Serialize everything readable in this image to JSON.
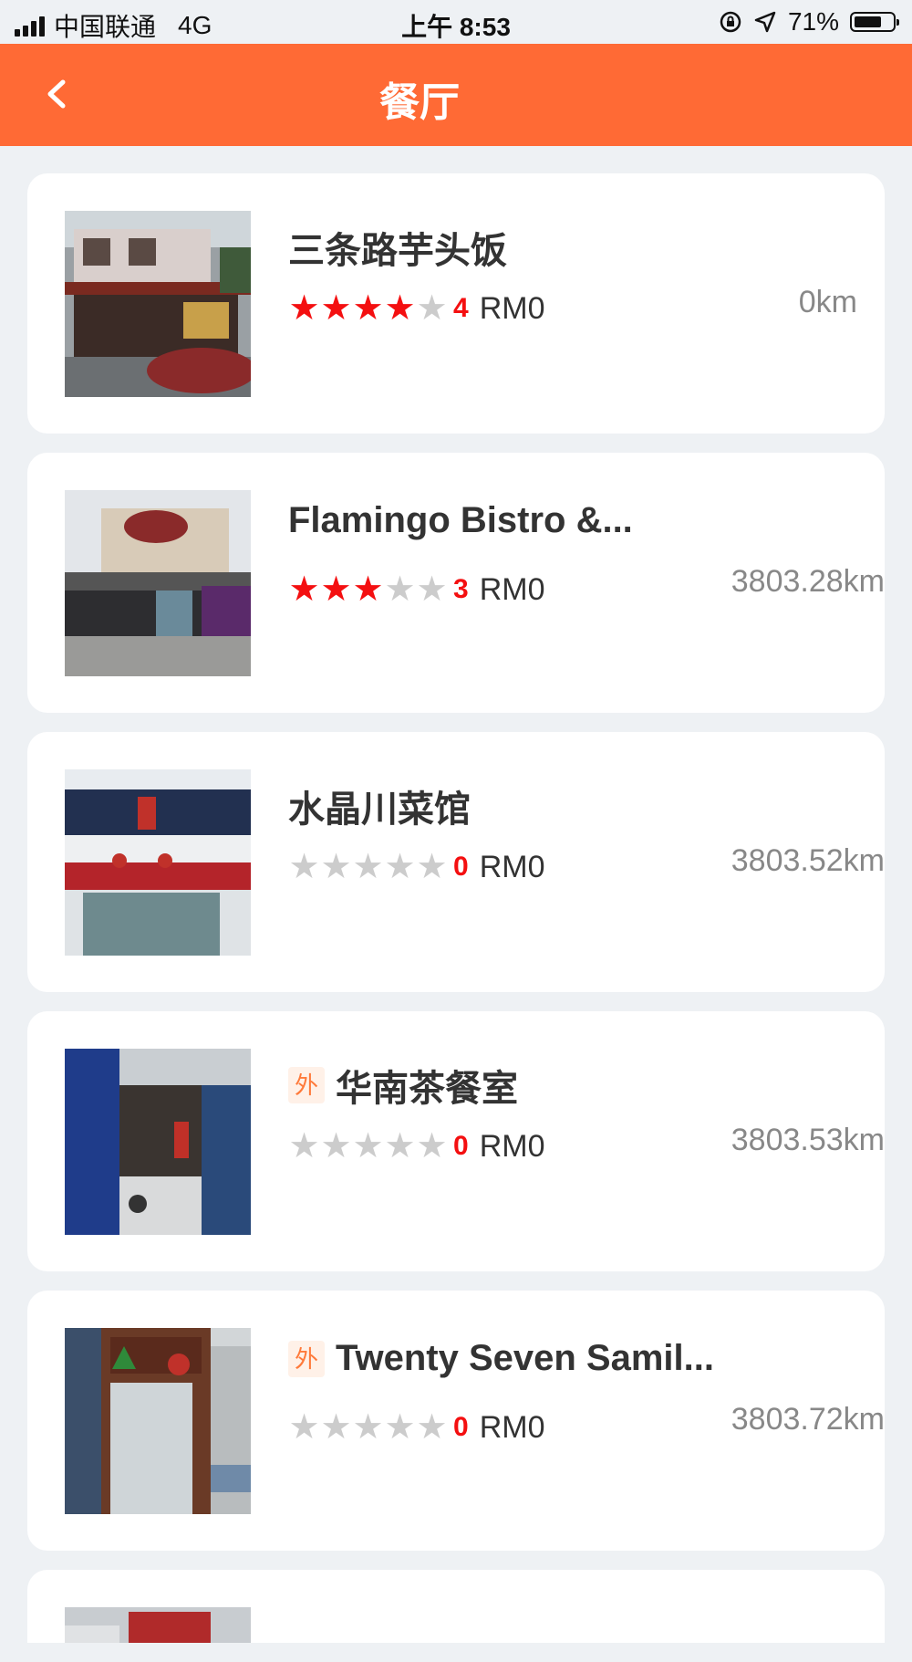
{
  "status_bar": {
    "carrier": "中国联通",
    "network": "4G",
    "time": "上午 8:53",
    "battery": "71%"
  },
  "nav": {
    "title": "餐厅",
    "back_icon": "chevron-left-icon"
  },
  "restaurants": [
    {
      "name": "三条路芋头饭",
      "badge": "",
      "stars": 4,
      "score": "4",
      "price": "RM0",
      "distance": "0km"
    },
    {
      "name": "Flamingo Bistro &...",
      "badge": "",
      "stars": 3,
      "score": "3",
      "price": "RM0",
      "distance": "3803.28km"
    },
    {
      "name": "水晶川菜馆",
      "badge": "",
      "stars": 0,
      "score": "0",
      "price": "RM0",
      "distance": "3803.52km"
    },
    {
      "name": "华南茶餐室",
      "badge": "外",
      "stars": 0,
      "score": "0",
      "price": "RM0",
      "distance": "3803.53km"
    },
    {
      "name": "Twenty Seven Samil...",
      "badge": "外",
      "stars": 0,
      "score": "0",
      "price": "RM0",
      "distance": "3803.72km"
    }
  ],
  "colors": {
    "accent": "#ff6a35",
    "star_active": "#f40f10",
    "star_inactive": "#cccccc",
    "badge_bg": "#fff1e8",
    "badge_text": "#ff7a3a"
  }
}
